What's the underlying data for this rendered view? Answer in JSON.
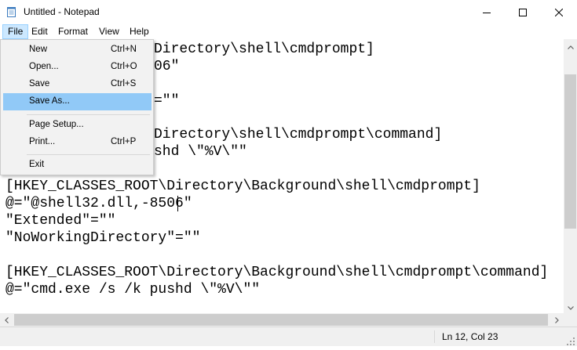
{
  "window": {
    "title": "Untitled - Notepad",
    "app_icon": "notepad-icon",
    "controls": [
      "minimize-icon",
      "maximize-icon",
      "close-icon"
    ]
  },
  "menubar": {
    "items": [
      "File",
      "Edit",
      "Format",
      "View",
      "Help"
    ],
    "active": "File"
  },
  "file_menu": {
    "items": [
      {
        "label": "New",
        "shortcut": "Ctrl+N"
      },
      {
        "label": "Open...",
        "shortcut": "Ctrl+O"
      },
      {
        "label": "Save",
        "shortcut": "Ctrl+S"
      },
      {
        "label": "Save As...",
        "shortcut": ""
      },
      {
        "label": "Page Setup...",
        "shortcut": ""
      },
      {
        "label": "Print...",
        "shortcut": "Ctrl+P"
      },
      {
        "label": "Exit",
        "shortcut": ""
      }
    ],
    "highlighted": "Save As..."
  },
  "editor": {
    "visible_lines": [
      "Directory\\shell\\cmdprompt]",
      "06\"",
      "",
      "=\"\"",
      "",
      "Directory\\shell\\cmdprompt\\command]",
      "shd \\\"%V\\\"\"",
      "",
      "[HKEY_CLASSES_ROOT\\Directory\\Background\\shell\\cmdprompt]",
      "@=\"@shell32.dll,-8506\"",
      "\"Extended\"=\"\"",
      "\"NoWorkingDirectory\"=\"\"",
      "",
      "[HKEY_CLASSES_ROOT\\Directory\\Background\\shell\\cmdprompt\\command]",
      "@=\"cmd.exe /s /k pushd \\\"%V\\\"\""
    ]
  },
  "statusbar": {
    "position": "Ln 12, Col 23"
  }
}
